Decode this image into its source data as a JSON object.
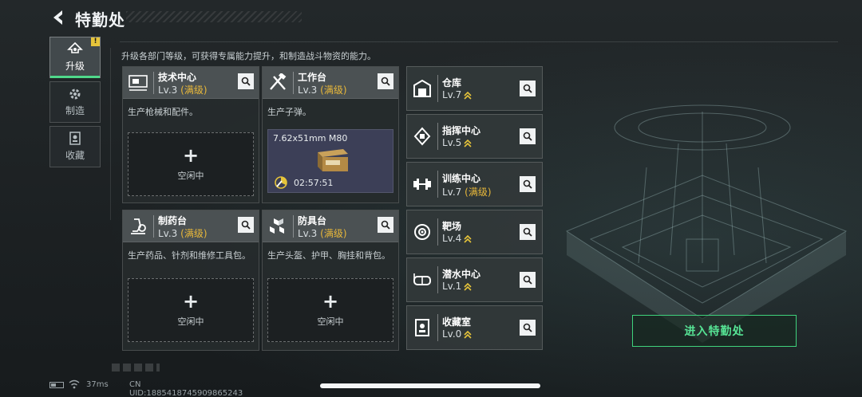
{
  "header": {
    "title": "特勤处"
  },
  "description": "升级各部门等级，可获得专属能力提升，和制造战斗物资的能力。",
  "nav": [
    {
      "label": "升级",
      "icon": "upgrade-icon",
      "active": true,
      "badge": "!"
    },
    {
      "label": "制造",
      "icon": "gear-icon",
      "active": false
    },
    {
      "label": "收藏",
      "icon": "collection-icon",
      "active": false
    }
  ],
  "departments": [
    {
      "name": "技术中心",
      "level": "Lv.3",
      "maxed": "(满级)",
      "desc": "生产枪械和配件。",
      "slot": {
        "plus": "+",
        "label": "空闲中"
      },
      "icon": "tech-center-icon"
    },
    {
      "name": "工作台",
      "level": "Lv.3",
      "maxed": "(满级)",
      "desc": "生产子弹。",
      "craft": {
        "item": "7.62x51mm M80",
        "timer": "02:57:51"
      },
      "icon": "workbench-icon"
    },
    {
      "name": "制药台",
      "level": "Lv.3",
      "maxed": "(满级)",
      "desc": "生产药品、针剂和维修工具包。",
      "slot": {
        "plus": "+",
        "label": "空闲中"
      },
      "icon": "pharmacy-icon"
    },
    {
      "name": "防具台",
      "level": "Lv.3",
      "maxed": "(满级)",
      "desc": "生产头盔、护甲、胸挂和背包。",
      "slot": {
        "plus": "+",
        "label": "空闲中"
      },
      "icon": "armor-bench-icon"
    }
  ],
  "facilities": [
    {
      "name": "仓库",
      "level": "Lv.7",
      "maxed": "",
      "upgradable": true,
      "icon": "warehouse-icon"
    },
    {
      "name": "指挥中心",
      "level": "Lv.5",
      "maxed": "",
      "upgradable": true,
      "icon": "command-center-icon"
    },
    {
      "name": "训练中心",
      "level": "Lv.7",
      "maxed": "(满级)",
      "upgradable": false,
      "icon": "training-center-icon"
    },
    {
      "name": "靶场",
      "level": "Lv.4",
      "maxed": "",
      "upgradable": true,
      "icon": "shooting-range-icon"
    },
    {
      "name": "潜水中心",
      "level": "Lv.1",
      "maxed": "",
      "upgradable": true,
      "icon": "diving-center-icon"
    },
    {
      "name": "收藏室",
      "level": "Lv.0",
      "maxed": "",
      "upgradable": true,
      "icon": "collection-room-icon"
    }
  ],
  "enter_button": "进入特勤处",
  "status": {
    "ping": "37ms",
    "uid": "CN UID:1885418745909865243"
  },
  "colors": {
    "accent_green": "#3fd27c",
    "maxed_gold": "#e8b83a",
    "upgrade_arrow": "#e6c43a",
    "badge_yellow": "#e6c43a"
  }
}
